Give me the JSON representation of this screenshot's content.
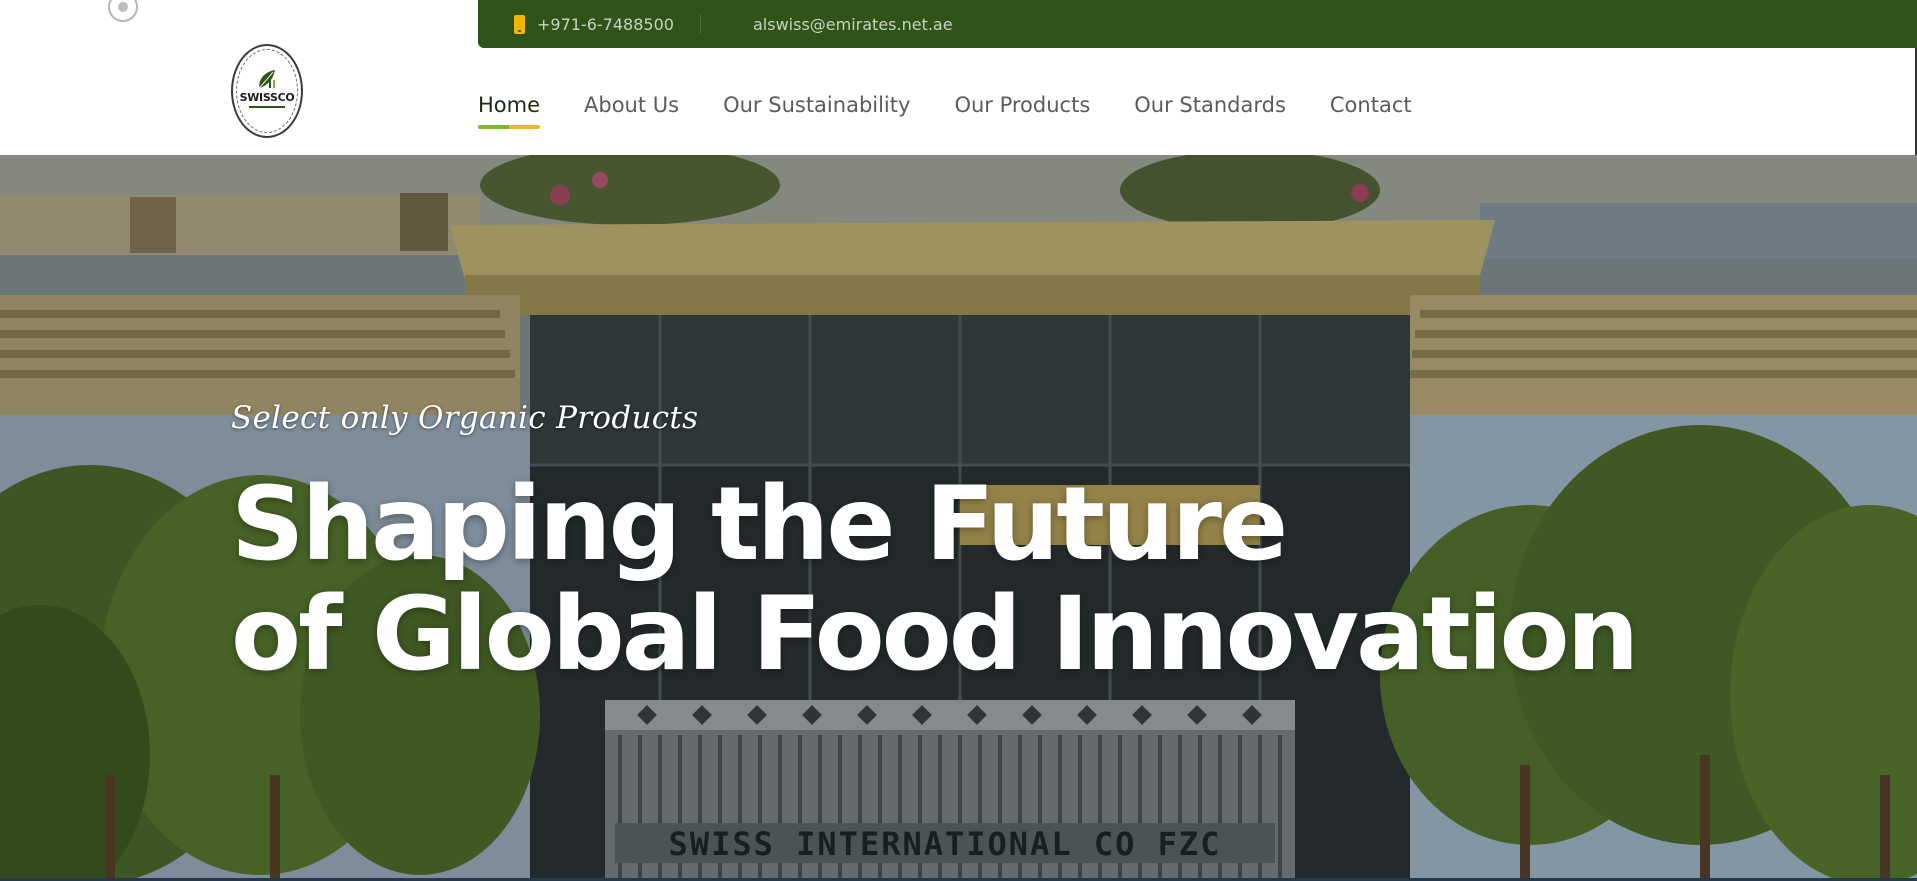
{
  "topbar": {
    "phone": "+971-6-7488500",
    "email": "alswiss@emirates.net.ae"
  },
  "logo": {
    "text": "SWISSCO"
  },
  "nav": {
    "items": [
      {
        "label": "Home",
        "active": true
      },
      {
        "label": "About Us",
        "active": false
      },
      {
        "label": "Our Sustainability",
        "active": false
      },
      {
        "label": "Our Products",
        "active": false
      },
      {
        "label": "Our Standards",
        "active": false
      },
      {
        "label": "Contact",
        "active": false
      }
    ]
  },
  "hero": {
    "tagline": "Select only Organic Products",
    "title_line1": "Shaping the Future",
    "title_line2": "of Global Food Innovation",
    "building_sign": "SWISS INTERNATIONAL CO FZC"
  },
  "colors": {
    "topbar_bg": "#2f5319",
    "nav_active_green": "#7fb43a",
    "nav_active_yellow": "#f1b52c",
    "phone_icon": "#f2b500"
  },
  "icons": {
    "phone": "phone-icon",
    "logo_leaf": "leaf-icon"
  }
}
